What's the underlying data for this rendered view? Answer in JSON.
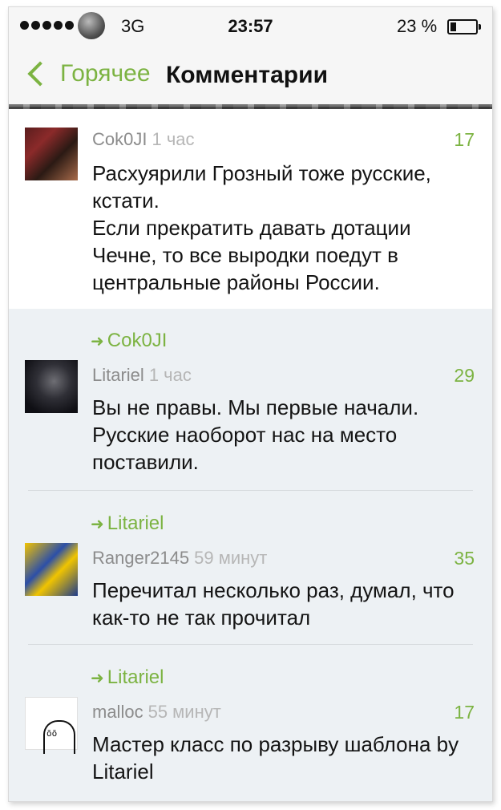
{
  "status_bar": {
    "network": "3G",
    "time": "23:57",
    "battery": "23 %",
    "battery_level": 0.23
  },
  "navbar": {
    "back_label": "Горячее",
    "title": "Комментарии"
  },
  "colors": {
    "accent": "#7cb342",
    "reply_bg": "#edf1f4"
  },
  "comments": [
    {
      "author": "Cok0JI",
      "ago": "1 час",
      "score": "17",
      "text": "Расхуярили Грозный тоже русские, кстати.\nЕсли прекратить давать дотации Чечне, то все выродки поедут в центральные районы России."
    }
  ],
  "replies": [
    {
      "reply_to": "Cok0JI",
      "author": "Litariel",
      "ago": "1 час",
      "score": "29",
      "text": "Вы не правы. Мы первые начали. Русские наоборот нас на место поставили."
    },
    {
      "reply_to": "Litariel",
      "author": "Ranger2145",
      "ago": "59 минут",
      "score": "35",
      "text": "Перечитал несколько раз, думал, что как-то не так прочитал"
    },
    {
      "reply_to": "Litariel",
      "author": "malloc",
      "ago": "55 минут",
      "score": "17",
      "text": "Мастер класс по разрыву шаблона by Litariel"
    }
  ]
}
